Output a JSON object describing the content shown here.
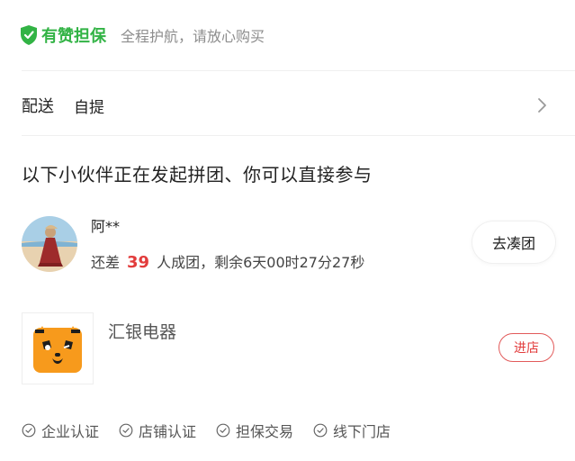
{
  "guarantee": {
    "title": "有赞担保",
    "desc": "全程护航，请放心购买",
    "color": "#32b345"
  },
  "delivery": {
    "label": "配送",
    "value": "自提"
  },
  "group": {
    "heading": "以下小伙伴正在发起拼团、你可以直接参与",
    "member": {
      "name": "阿**",
      "status_prefix": "还差",
      "remaining_count": "39",
      "status_suffix": "人成团，剩余6天00时27分27秒"
    },
    "join_label": "去凑团"
  },
  "store": {
    "name": "汇银电器",
    "enter_label": "进店"
  },
  "badges": [
    {
      "label": "企业认证"
    },
    {
      "label": "店铺认证"
    },
    {
      "label": "担保交易"
    },
    {
      "label": "线下门店"
    }
  ],
  "colors": {
    "accent_green": "#32b345",
    "accent_red": "#e23c3c"
  }
}
